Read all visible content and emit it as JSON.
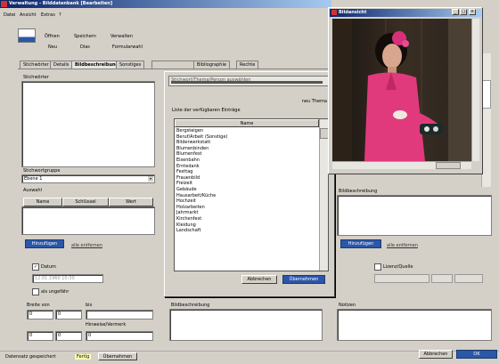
{
  "main_window": {
    "title": "Verwaltung - Bilddatenbank [Bearbeiten]",
    "menu": [
      "Datei",
      "Ansicht",
      "Extras",
      "?"
    ],
    "toolbar": {
      "row1": [
        "Öffnen",
        "Speichern",
        "Verwalten"
      ],
      "row2": [
        "Neu",
        "Dias",
        "Formularwahl"
      ]
    },
    "tabs": [
      "Stichwörter",
      "Details",
      "Bildbeschreibung",
      "Sonstiges",
      "",
      "Bibliographie",
      "Rechte"
    ],
    "left": {
      "top_label": "Stichwörter",
      "group_label": "Stichwortgruppe",
      "group_value": "Ebene 1",
      "list_label": "Auswahl",
      "col_headers": [
        "Name",
        "Schlüssel",
        "Wert"
      ],
      "action_button": "Hinzufügen",
      "action_link": "alle entfernen",
      "check_label": "Datum",
      "check2_label": "als ungefähr",
      "date_value": "12.01.1960  10:30",
      "from_label": "Breite von",
      "to_label": "bis",
      "field_a": "0",
      "field_b": "0",
      "field_c": "",
      "field_d": "0",
      "field_e": "0",
      "field_f": "0",
      "note_label": "Hinweise/Vermerk"
    },
    "center_bottom_label": "Bildbeschreibung",
    "right": {
      "box_label": "Bildbeschreibung",
      "action_button": "Hinzufügen",
      "action_link": "alle entfernen",
      "check_label": "Lizenz/Quelle",
      "bottom_label": "Notizen"
    },
    "status": {
      "left": "Datensatz gespeichert",
      "mid": "Fertig",
      "button": "Übernehmen"
    },
    "footer_buttons": [
      "Abbrechen",
      "OK"
    ]
  },
  "dialog": {
    "combo_value": "Stichwort/Thema/Person auswählen",
    "top_right_label": "neu Thema",
    "hint": "Liste der verfügbaren Einträge",
    "list_header": "Name",
    "items": [
      "Bergsteigen",
      "Beruf/Arbeit (Sonstige)",
      "Bilderwerkstatt",
      "Blumenbinden",
      "Blumenfest",
      "Eisenbahn",
      "Erntedank",
      "Festtag",
      "Frauenbild",
      "Freizeit",
      "Gebäude",
      "Hausarbeit/Küche",
      "Hochzeit",
      "Holzarbeiten",
      "Jahrmarkt",
      "Kirchenfest",
      "Kleidung",
      "Landschaft"
    ],
    "cancel": "Abbrechen",
    "ok": "Übernehmen"
  },
  "photo_window": {
    "title": "Bildansicht"
  }
}
